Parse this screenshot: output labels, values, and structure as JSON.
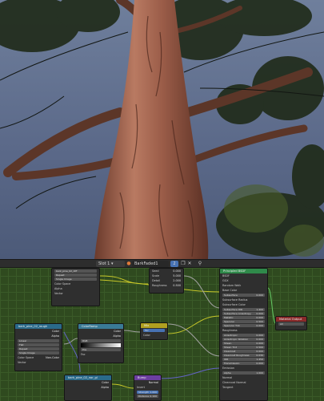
{
  "header": {
    "slot_label": "Slot 1",
    "material_name": "BarkFaded1",
    "user_count": "2",
    "icons": [
      "dropdown-arrow-icon",
      "material-sphere-icon",
      "duplicate-icon",
      "close-icon",
      "pin-icon"
    ]
  },
  "nodes": {
    "top_small": {
      "title": "",
      "rows": [
        "Seed",
        "Scale",
        "Detail",
        "Roughness"
      ],
      "values": [
        "0.000",
        "5.000",
        "2.000",
        "0.500"
      ]
    },
    "image_texture_1": {
      "title": "bark_pine_02_diff",
      "rows": [
        "Color",
        "Alpha",
        "Repeat",
        "Single Image",
        "Color Space",
        "Alpha",
        "Vector"
      ]
    },
    "image_texture_2": {
      "title": "bark_pine_02_rough",
      "rows": [
        "Color",
        "Alpha",
        "Linear",
        "Flat",
        "Repeat",
        "Single Image",
        "Color Space",
        "Non-Color",
        "Vector"
      ]
    },
    "color_ramp": {
      "title": "ColorRamp",
      "outputs": [
        "Color",
        "Alpha"
      ],
      "rows": [
        "RGB",
        "Linear",
        "Pos",
        "Fac"
      ]
    },
    "mix": {
      "title": "Mix",
      "rows": [
        "Result",
        "Mix",
        "Fac",
        "Color",
        "Color"
      ]
    },
    "bump": {
      "title": "Bump",
      "rows": [
        "Normal",
        "Invert",
        "Strength",
        "Distance",
        "Height",
        "Normal"
      ],
      "values": [
        "",
        "",
        "1.000",
        "0.100",
        "",
        ""
      ]
    },
    "image_texture_3": {
      "title": "bark_pine_02_nor_gl",
      "rows": [
        "Color",
        "Alpha"
      ]
    },
    "principled": {
      "title": "Principled BSDF",
      "rows": [
        "BSDF",
        "GGX",
        "Random Walk",
        "Base Color",
        "Subsurface",
        "Subsurface Radius",
        "Subsurface Color",
        "Subsurface IOR",
        "Subsurface Anisotropy",
        "Metallic",
        "Specular",
        "Specular Tint",
        "Roughness",
        "Anisotropic",
        "Anisotropic Rotation",
        "Sheen",
        "Sheen Tint",
        "Clearcoat",
        "Clearcoat Roughness",
        "IOR",
        "Transmission",
        "Emission",
        "Alpha",
        "Normal",
        "Clearcoat Normal",
        "Tangent"
      ],
      "values": [
        "",
        "",
        "",
        "",
        "0.000",
        "",
        "",
        "1.400",
        "0.000",
        "0.000",
        "0.500",
        "0.000",
        "",
        "0.000",
        "0.000",
        "0.000",
        "0.500",
        "0.000",
        "0.030",
        "1.450",
        "0.000",
        "",
        "1.000",
        "",
        "",
        ""
      ]
    },
    "output": {
      "title": "Material Output",
      "rows": [
        "All",
        "Surface",
        "Volume",
        "Displacement"
      ]
    }
  }
}
